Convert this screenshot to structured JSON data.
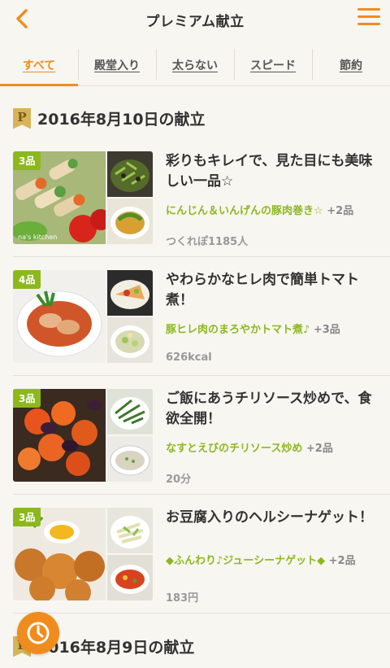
{
  "header": {
    "title": "プレミアム献立"
  },
  "tabs": [
    {
      "label": "すべて"
    },
    {
      "label": "殿堂入り"
    },
    {
      "label": "太らない"
    },
    {
      "label": "スピード"
    },
    {
      "label": "節約"
    }
  ],
  "sections": [
    {
      "title": "2016年8月10日の献立",
      "badge": "P"
    },
    {
      "title": "2016年8月9日の献立"
    }
  ],
  "cards": [
    {
      "count": "3品",
      "title": "彩りもキレイで、見た目にも美味しい一品☆",
      "dish": "にんじん＆いんげんの豚肉巻き☆",
      "more": "+2品",
      "meta": "つくれぽ1185人",
      "watermark": "na's kitchen"
    },
    {
      "count": "4品",
      "title": "やわらかなヒレ肉で簡単トマト煮！",
      "dish": "豚ヒレ肉のまろやかトマト煮♪",
      "more": "+3品",
      "meta": "626kcal"
    },
    {
      "count": "3品",
      "title": "ご飯にあうチリソース炒めで、食欲全開！",
      "dish": "なすとえびのチリソース炒め",
      "more": "+2品",
      "meta": "20分"
    },
    {
      "count": "3品",
      "title": "お豆腐入りのヘルシーナゲット！",
      "dish": "◆ふんわり♪ジューシーナゲット◆",
      "more": "+2品",
      "meta": "183円"
    }
  ],
  "colors": {
    "accent": "#f08c1e",
    "green": "#8cb81e",
    "background": "#f7f6f1"
  }
}
